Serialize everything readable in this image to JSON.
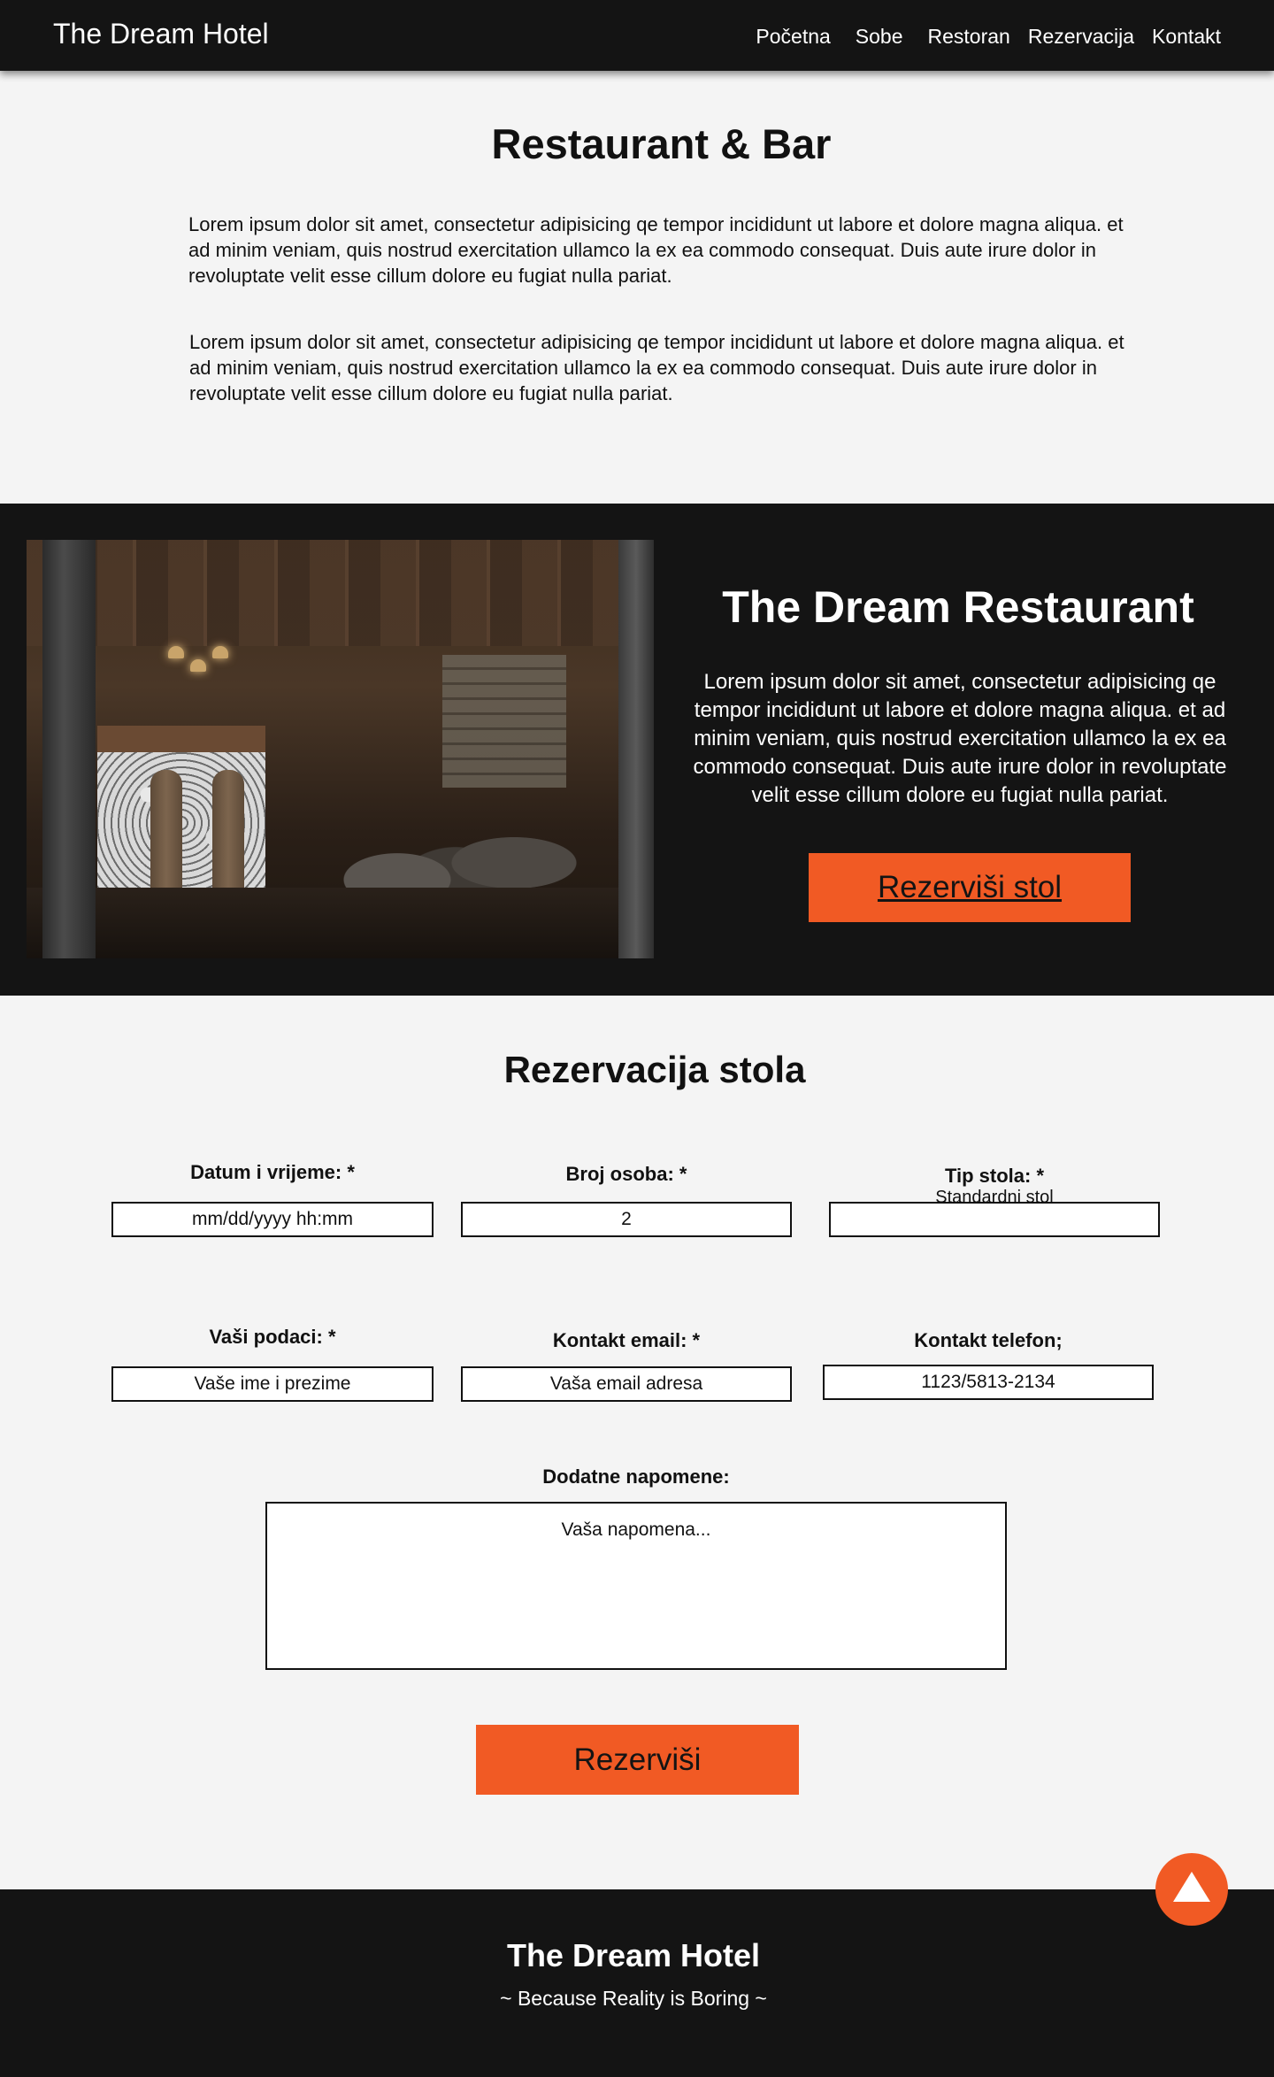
{
  "nav": {
    "brand": "The Dream Hotel",
    "links": [
      "Početna",
      "Sobe",
      "Restoran",
      "Rezervacija",
      "Kontakt"
    ]
  },
  "intro": {
    "title": "Restaurant & Bar",
    "paragraphs": [
      "Lorem ipsum dolor sit amet, consectetur adipisicing qe tempor incididunt ut labore et dolore magna aliqua. et ad minim veniam, quis nostrud exercitation ullamco la  ex ea commodo consequat. Duis aute irure dolor in revoluptate velit esse cillum dolore eu fugiat nulla pariat.",
      "Lorem ipsum dolor sit amet, consectetur adipisicing qe tempor incididunt ut labore et dolore magna aliqua. et ad minim veniam, quis nostrud exercitation ullamco la  ex ea commodo consequat. Duis aute irure dolor in revoluptate velit esse cillum dolore eu fugiat nulla pariat."
    ]
  },
  "restaurant": {
    "title": "The Dream Restaurant",
    "text": "Lorem ipsum dolor sit amet, consectetur adipisicing qe tempor incididunt ut labore et dolore magna aliqua. et ad minim veniam, quis nostrud exercitation ullamco la  ex ea commodo consequat. Duis aute irure dolor in revoluptate velit esse cillum dolore eu fugiat nulla pariat.",
    "button": "Rezerviši stol"
  },
  "form": {
    "title": "Rezervacija stola",
    "datetime": {
      "label": "Datum i vrijeme: *",
      "placeholder": "mm/dd/yyyy hh:mm"
    },
    "guests": {
      "label": "Broj osoba: *",
      "value": "2"
    },
    "table_type": {
      "label": "Tip stola: *",
      "value": "Standardni stol"
    },
    "name": {
      "label": "Vaši podaci: *",
      "placeholder": "Vaše ime i prezime"
    },
    "email": {
      "label": "Kontakt email: *",
      "placeholder": "Vaša email adresa"
    },
    "phone": {
      "label": "Kontakt telefon;",
      "placeholder": "1123/5813-2134"
    },
    "notes": {
      "label": "Dodatne napomene:",
      "placeholder": "Vaša napomena..."
    },
    "submit": "Rezerviši"
  },
  "footer": {
    "title": "The Dream Hotel",
    "tagline": "~ Because Reality is Boring ~"
  },
  "colors": {
    "accent": "#f15a24",
    "dark": "#141414",
    "background": "#f4f4f4"
  },
  "icons": {
    "scroll_top": "arrow-up-icon"
  }
}
